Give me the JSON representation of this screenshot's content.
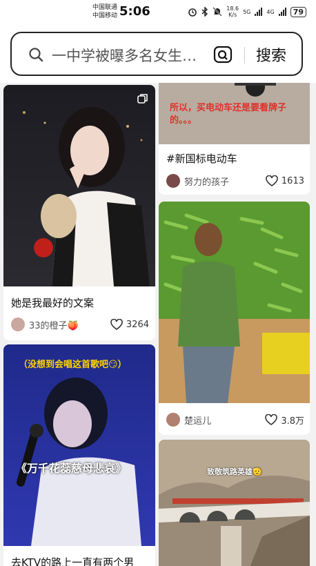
{
  "status_bar": {
    "carrier1": "中国联通",
    "carrier2": "中国移动",
    "time": "5:06",
    "speed_value": "18.6",
    "speed_unit": "K/s",
    "net1": "5G",
    "net2": "4G",
    "battery": "79"
  },
  "search": {
    "query": "一中学被曝多名女生…",
    "button_label": "搜索"
  },
  "feed": {
    "cards": [
      {
        "title": "她是我最好的文案",
        "author": "33的橙子🍑",
        "likes": "3264"
      },
      {
        "overlay_text": "（没想到会唱这首歌吧😏）",
        "overlay_text2": "《万千花蕊慈母悲哀》",
        "title": "去KTV的路上一直有两个男"
      },
      {
        "overlay_text": "所以，买电动车还是要看牌子的。。。",
        "title": "#新国标电动车",
        "author": "努力的孩子",
        "likes": "1613"
      },
      {
        "title": "",
        "author": "楚运儿",
        "likes": "3.8万"
      },
      {
        "overlay_text": "致敬筑路英雄🫡"
      }
    ]
  },
  "colors": {
    "heart": "#333333",
    "overlay_red": "#e0302a"
  }
}
